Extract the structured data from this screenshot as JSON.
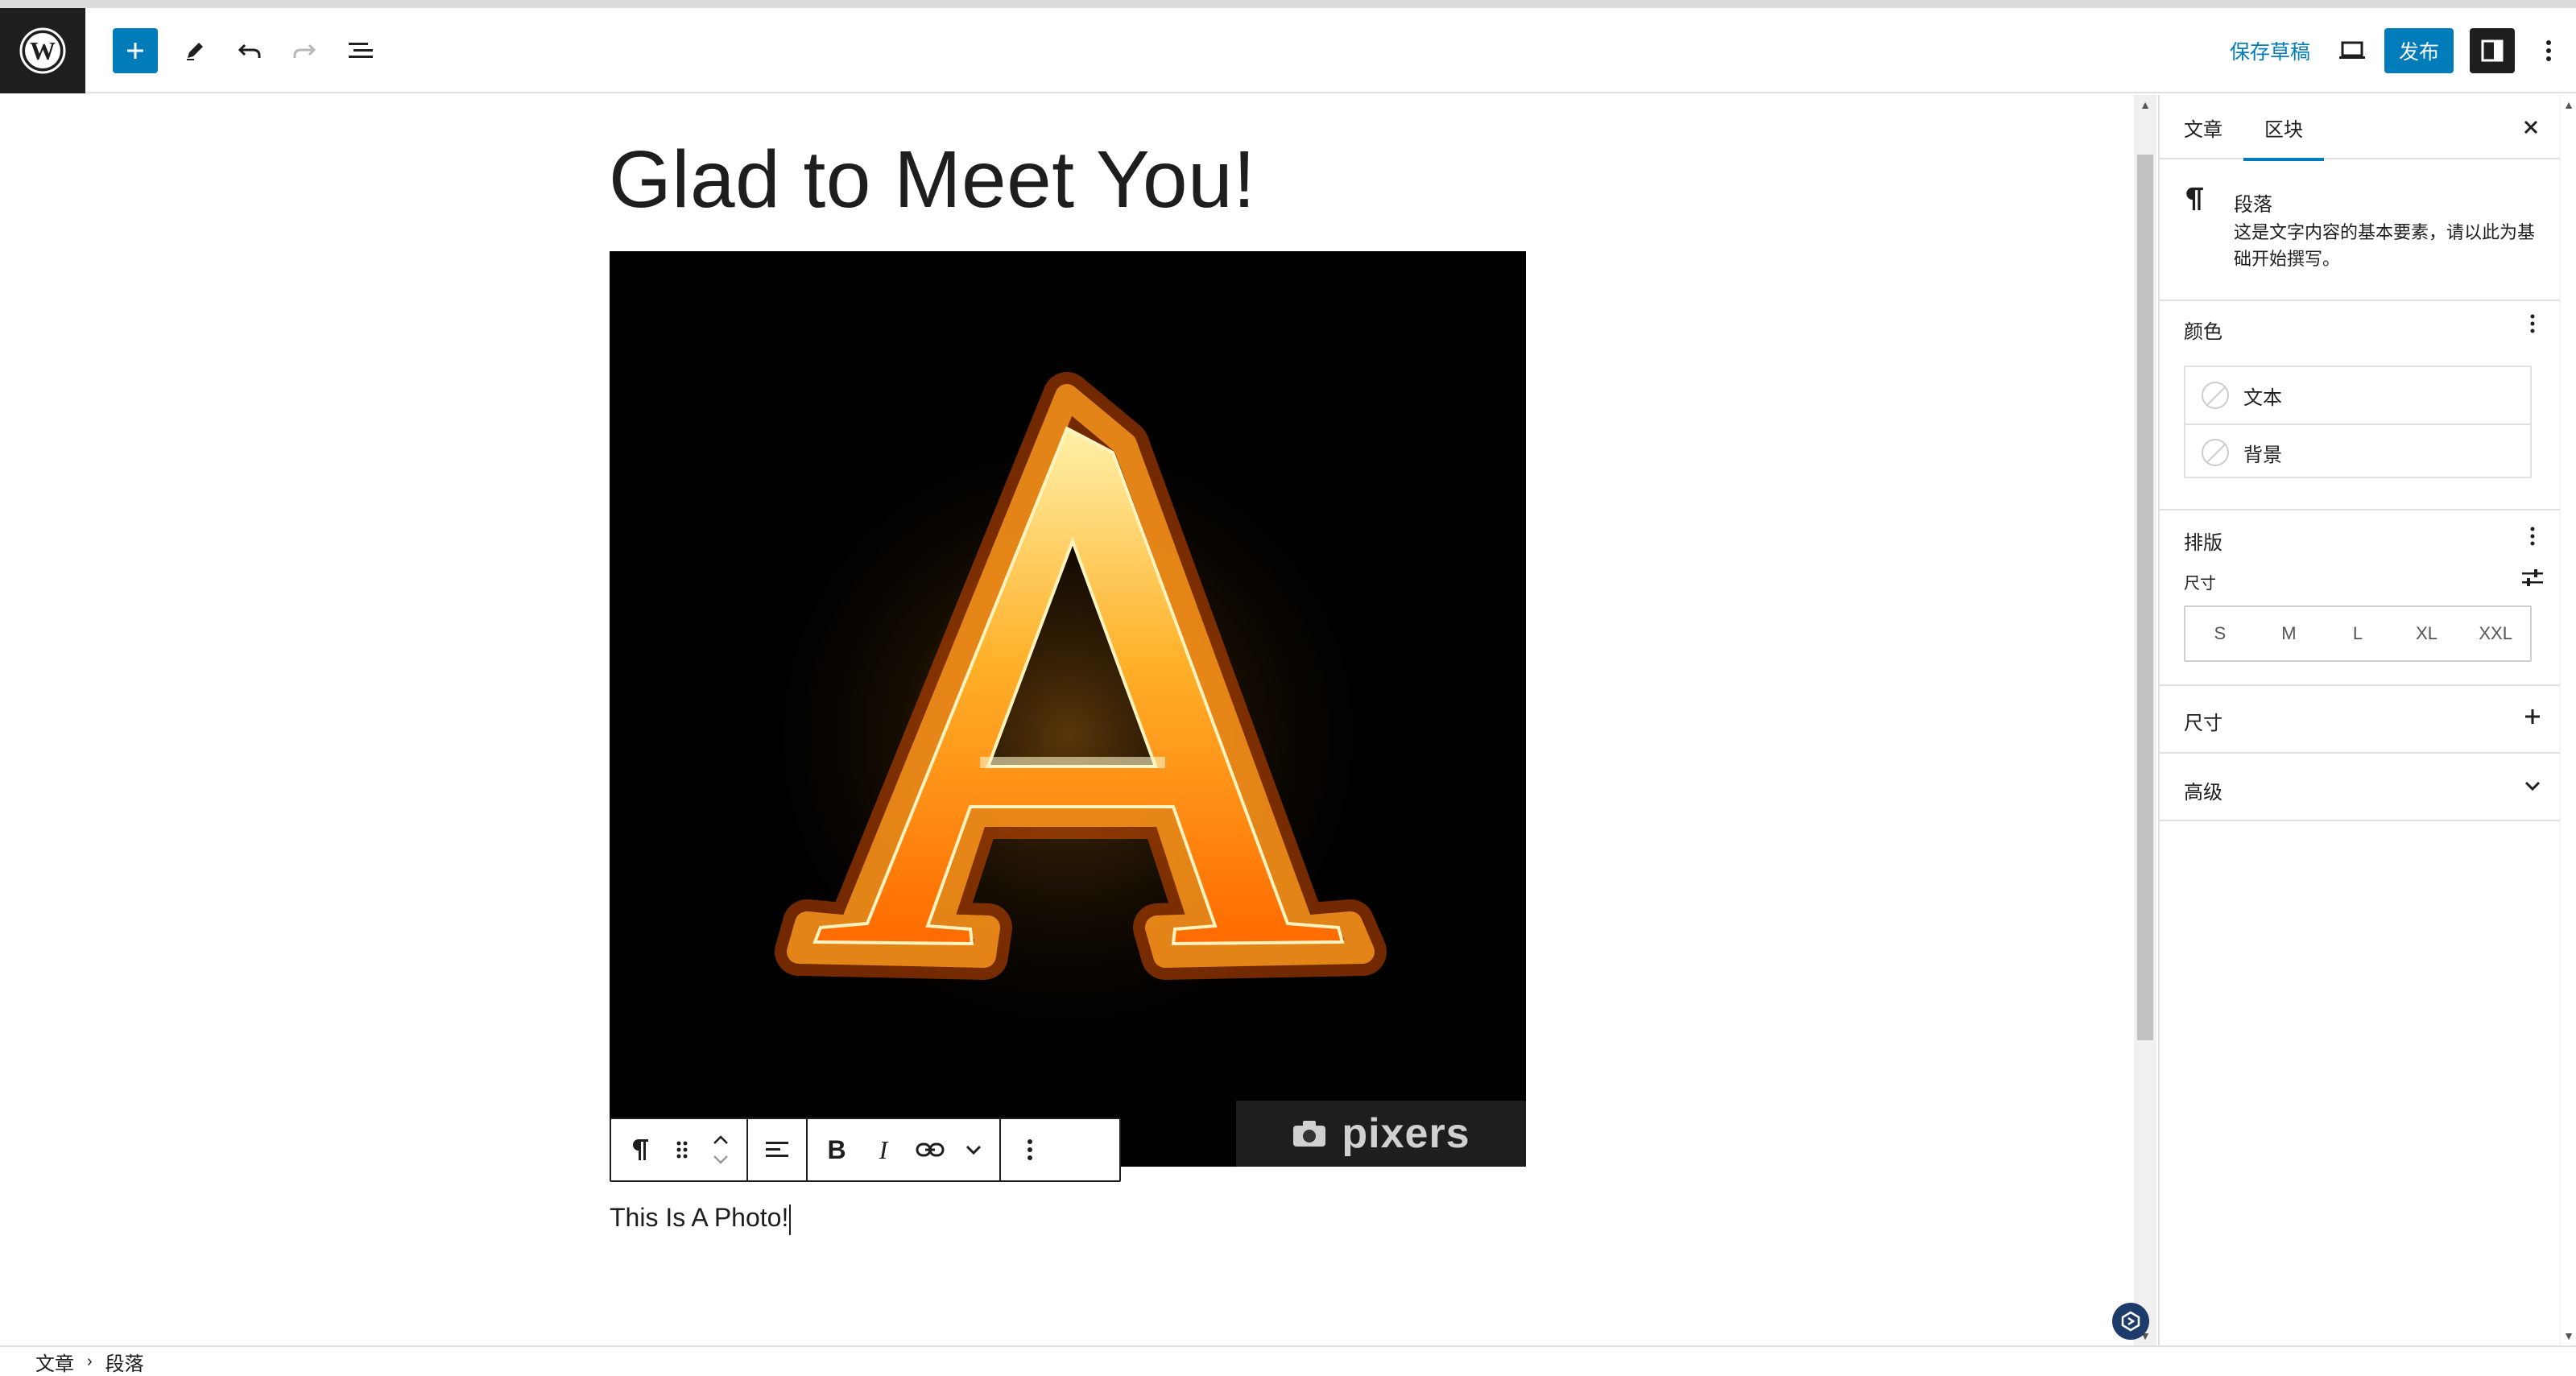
{
  "header": {
    "save_draft": "保存草稿",
    "publish": "发布"
  },
  "post": {
    "title": "Glad to Meet You!",
    "paragraph": "This Is A Photo!",
    "image_watermark": "pixers"
  },
  "sidebar": {
    "tabs": [
      {
        "label": "文章",
        "active": false
      },
      {
        "label": "区块",
        "active": true
      }
    ],
    "block": {
      "name": "段落",
      "description": "这是文字内容的基本要素，请以此为基础开始撰写。"
    },
    "color": {
      "title": "颜色",
      "items": [
        "文本",
        "背景"
      ]
    },
    "typography": {
      "title": "排版",
      "size_label": "尺寸",
      "sizes": [
        "S",
        "M",
        "L",
        "XL",
        "XXL"
      ]
    },
    "dimensions": {
      "title": "尺寸"
    },
    "advanced": {
      "title": "高级"
    }
  },
  "breadcrumb": [
    "文章",
    "段落"
  ],
  "colors": {
    "accent": "#007cba",
    "dark": "#1e1e1e",
    "border": "#e0e0e0"
  }
}
